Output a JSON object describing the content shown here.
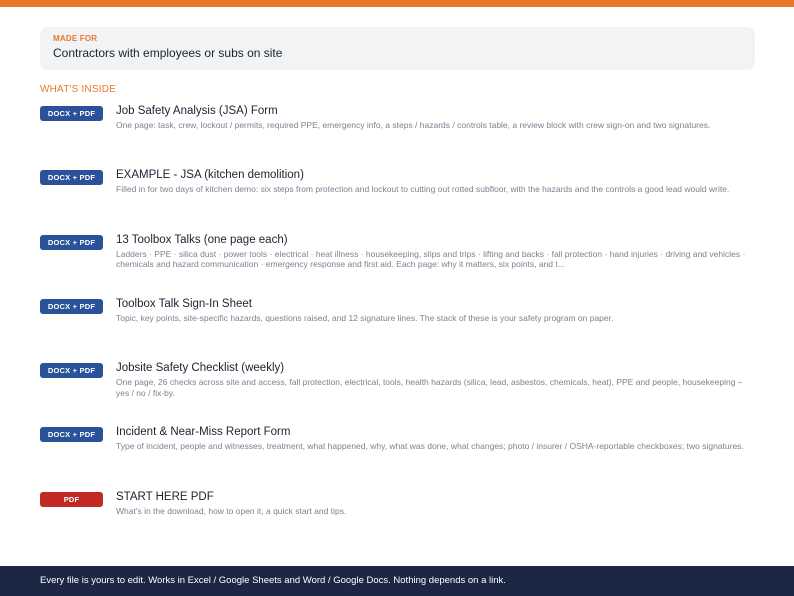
{
  "colors": {
    "accent": "#e8782a",
    "docx_badge": "#2b5198",
    "pdf_badge": "#c02a22",
    "footer_bg": "#1c2745"
  },
  "made_for": {
    "label": "MADE FOR",
    "value": "Contractors with employees or subs on site"
  },
  "section_title": "WHAT'S INSIDE",
  "items": [
    {
      "badge": "DOCX + PDF",
      "title": "Job Safety Analysis (JSA) Form",
      "desc": "One page: task, crew, lockout / permits, required PPE, emergency info, a steps / hazards / controls table, a review block with crew sign-on and two signatures."
    },
    {
      "badge": "DOCX + PDF",
      "title": "EXAMPLE - JSA (kitchen demolition)",
      "desc": "Filled in for two days of kitchen demo: six steps from protection and lockout to cutting out rotted subfloor, with the hazards and the controls a good lead would write."
    },
    {
      "badge": "DOCX + PDF",
      "title": "13 Toolbox Talks (one page each)",
      "desc": "Ladders · PPE · silica dust · power tools · electrical · heat illness · housekeeping, slips and trips · lifting and backs · fall protection · hand injuries · driving and vehicles · chemicals and hazard communication · emergency response and first aid. Each page: why it matters, six points, and t..."
    },
    {
      "badge": "DOCX + PDF",
      "title": "Toolbox Talk Sign-In Sheet",
      "desc": "Topic, key points, site-specific hazards, questions raised, and 12 signature lines. The stack of these is your safety program on paper."
    },
    {
      "badge": "DOCX + PDF",
      "title": "Jobsite Safety Checklist (weekly)",
      "desc": "One page, 26 checks across site and access, fall protection, electrical, tools, health hazards (silica, lead, asbestos, chemicals, heat), PPE and people, housekeeping – yes / no / fix-by."
    },
    {
      "badge": "DOCX + PDF",
      "title": "Incident & Near-Miss Report Form",
      "desc": "Type of incident, people and witnesses, treatment, what happened, why, what was done, what changes; photo / insurer / OSHA-reportable checkboxes; two signatures."
    },
    {
      "badge": "PDF",
      "title": "START HERE PDF",
      "desc": "What's in the download, how to open it, a quick start and tips."
    }
  ],
  "footer": "Every file is yours to edit. Works in Excel / Google Sheets and Word / Google Docs. Nothing depends on a link."
}
